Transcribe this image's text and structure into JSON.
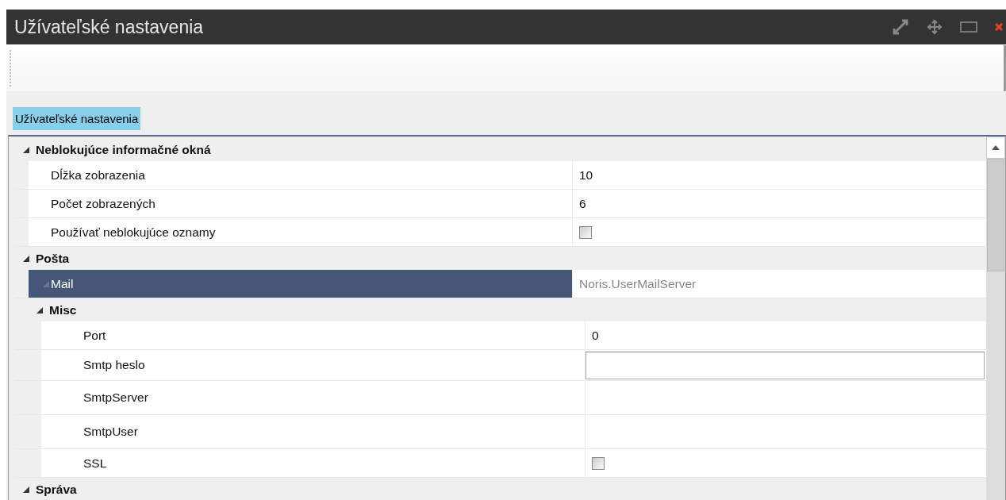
{
  "window": {
    "title": "Užívateľské nastavenia"
  },
  "section_label": "Užívateľské nastavenia",
  "categories": [
    {
      "label": "Neblokujúce informačné okná",
      "expanded": true,
      "children": [
        {
          "kind": "text",
          "label": "Dĺžka zobrazenia",
          "value": "10",
          "selected": false
        },
        {
          "kind": "text",
          "label": "Počet zobrazených",
          "value": "6",
          "selected": false
        },
        {
          "kind": "checkbox",
          "label": "Používať neblokujúce oznamy",
          "checked": false,
          "selected": false
        }
      ]
    },
    {
      "label": "Pošta",
      "expanded": true,
      "children": [
        {
          "kind": "object",
          "label": "Mail",
          "value": "Noris.UserMailServer",
          "selected": true,
          "expanded": true
        },
        {
          "kind": "category",
          "label": "Misc",
          "expanded": true,
          "children": [
            {
              "kind": "text",
              "label": "Port",
              "value": "0",
              "selected": false
            },
            {
              "kind": "field",
              "label": "Smtp heslo",
              "selected": false
            },
            {
              "kind": "empty",
              "label": "SmtpServer",
              "selected": false
            },
            {
              "kind": "empty",
              "label": "SmtpUser",
              "selected": false
            },
            {
              "kind": "checkbox",
              "label": "SSL",
              "checked": false,
              "selected": false
            }
          ]
        }
      ]
    },
    {
      "label": "Správa",
      "expanded": true
    }
  ]
}
